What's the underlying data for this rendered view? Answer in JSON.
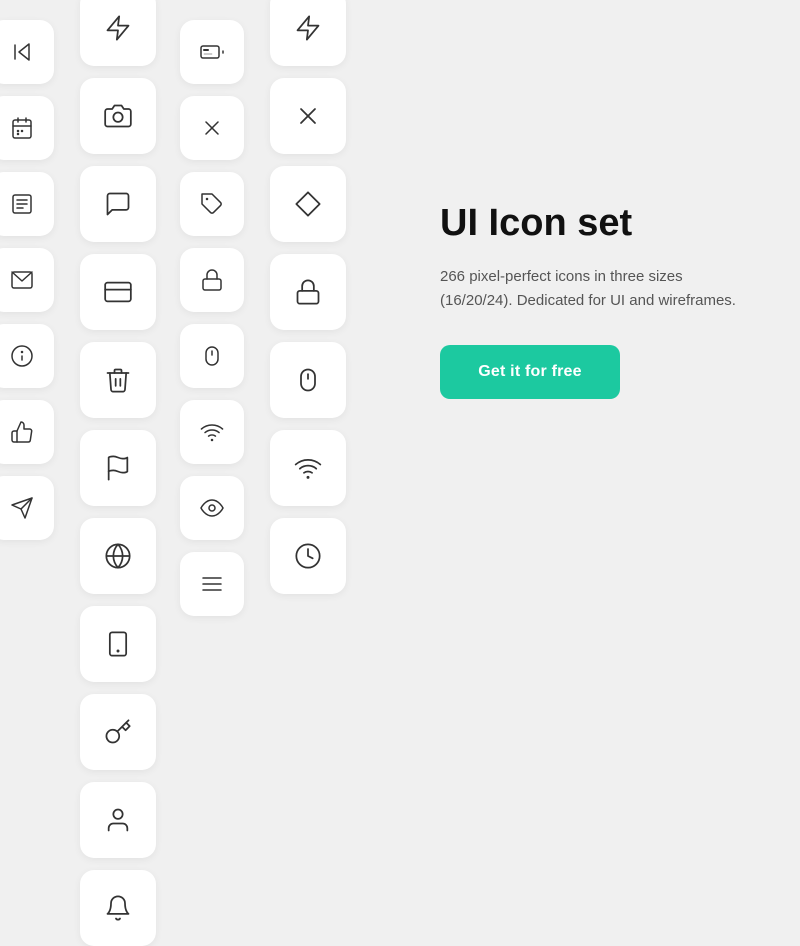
{
  "product": {
    "title": "UI Icon set",
    "description": "266 pixel-perfect icons in three sizes (16/20/24). Dedicated for UI and wireframes.",
    "cta_label": "Get it for free",
    "cta_color": "#1cc9a0"
  },
  "icons": {
    "col0": [
      "skip-back-icon",
      "calendar-icon",
      "news-icon",
      "mail-icon",
      "info-icon",
      "thumbs-up-icon",
      "send-icon"
    ],
    "col1": [
      "bolt-icon",
      "camera-icon",
      "chat-icon",
      "credit-card-icon",
      "trash-icon",
      "flag-icon",
      "globe-icon",
      "phone-icon",
      "key-icon",
      "user-icon",
      "bell-icon"
    ],
    "col2": [
      "battery-icon",
      "close-icon",
      "tag-icon",
      "lock-icon",
      "mouse-icon",
      "wifi-icon",
      "eye-icon",
      "menu-icon"
    ],
    "col3": [
      "bolt2-icon",
      "x-icon",
      "diamond-icon",
      "lock2-icon",
      "mouse2-icon",
      "wifi2-icon",
      "clock-icon"
    ]
  }
}
